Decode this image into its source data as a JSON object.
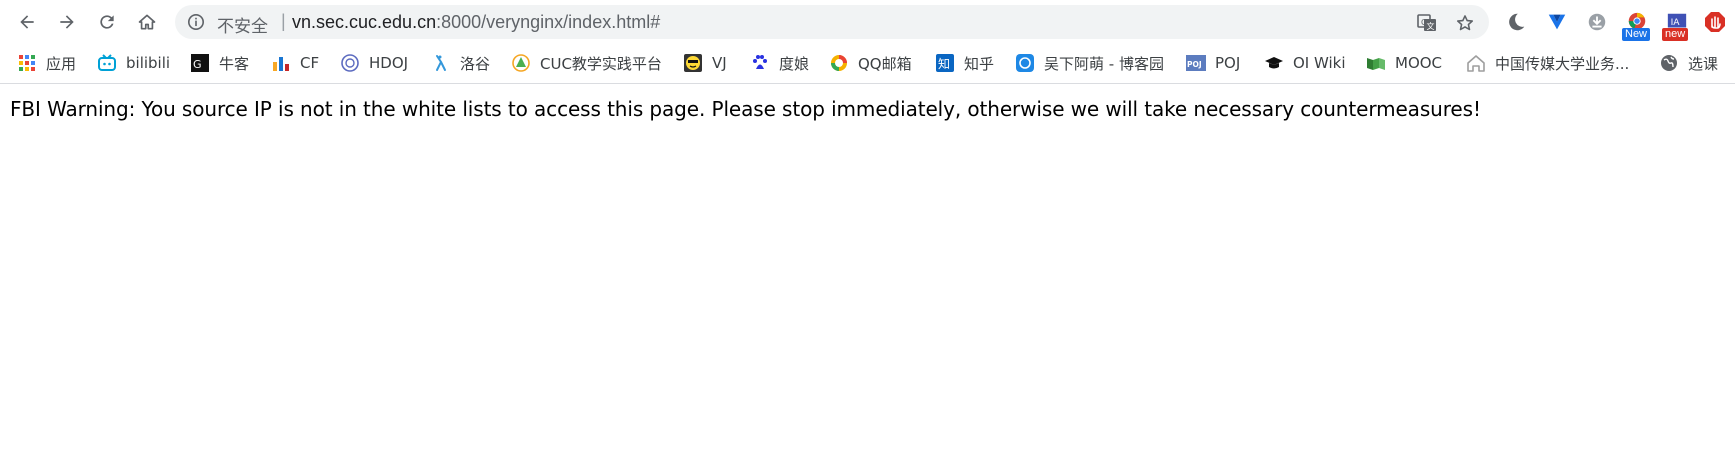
{
  "browser": {
    "security_text": "不安全",
    "separator": "|",
    "url_host": "vn.sec.cuc.edu.cn",
    "url_rest": ":8000/verynginx/index.html#"
  },
  "extensions": {
    "badge_new_1": "New",
    "badge_new_2": "new"
  },
  "bookmarks": [
    {
      "label": "应用",
      "icon": "apps-grid-icon"
    },
    {
      "label": "bilibili",
      "icon": "bilibili-icon"
    },
    {
      "label": "牛客",
      "icon": "nowcoder-icon"
    },
    {
      "label": "CF",
      "icon": "codeforces-icon"
    },
    {
      "label": "HDOJ",
      "icon": "hdoj-icon"
    },
    {
      "label": "洛谷",
      "icon": "luogu-icon"
    },
    {
      "label": "CUC教学实践平台",
      "icon": "cuc-platform-icon"
    },
    {
      "label": "VJ",
      "icon": "vjudge-icon"
    },
    {
      "label": "度娘",
      "icon": "baidu-icon"
    },
    {
      "label": "QQ邮箱",
      "icon": "qqmail-icon"
    },
    {
      "label": "知乎",
      "icon": "zhihu-icon"
    },
    {
      "label": "吴下阿萌 - 博客园",
      "icon": "cnblogs-icon"
    },
    {
      "label": "POJ",
      "icon": "poj-icon"
    },
    {
      "label": "OI Wiki",
      "icon": "oiwiki-icon"
    },
    {
      "label": "MOOC",
      "icon": "mooc-icon"
    },
    {
      "label": "中国传媒大学业务...",
      "icon": "cuc-home-icon"
    },
    {
      "label": "选课",
      "icon": "globe-icon"
    }
  ],
  "page": {
    "message": "FBI Warning: You source IP is not in the white lists to access this page. Please stop immediately, otherwise we will take necessary countermeasures!"
  },
  "colors": {
    "omnibox_bg": "#f1f3f4",
    "icon_gray": "#5f6368",
    "divider": "#dadce0"
  }
}
